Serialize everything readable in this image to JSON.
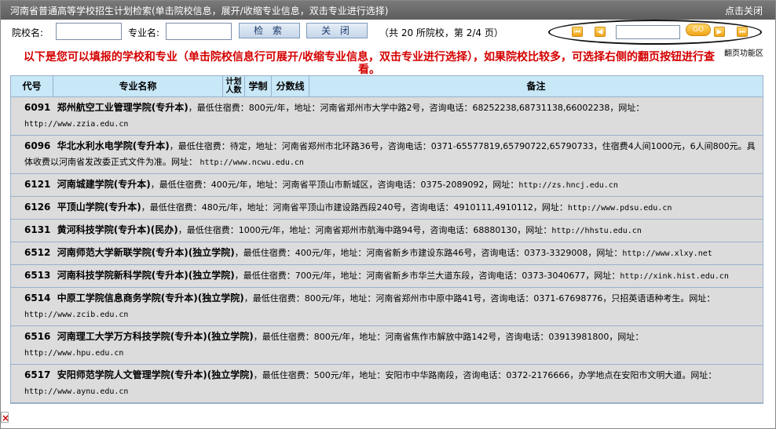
{
  "titlebar": {
    "title": "河南省普通高等学校招生计划检索(单击院校信息，展开/收缩专业信息，双击专业进行选择)",
    "close": "点击关闭"
  },
  "search": {
    "school_label": "院校名:",
    "school_value": "",
    "major_label": "专业名:",
    "major_value": "",
    "search_btn": "检 索",
    "close_btn": "关 闭",
    "page_info": "（共 20 所院校，第 2/4 页）"
  },
  "pager": {
    "first": "⏮",
    "prev": "◀",
    "input_value": "",
    "go": "GO",
    "next": "▶",
    "last": "⏭",
    "caption": "翻页功能区"
  },
  "notice": "以下是您可以填报的学校和专业（单击院校信息行可展开/收缩专业信息，双击专业进行选择），如果院校比较多，可选择右侧的翻页按钮进行查看。",
  "table": {
    "headers": [
      "代号",
      "专业名称",
      "计划人数",
      "学制",
      "分数线",
      "备注"
    ],
    "rows": [
      {
        "code": "6091",
        "name": "郑州航空工业管理学院(专升本)",
        "info": "，最低住宿费：800元/年，地址：河南省郑州市大学中路2号，咨询电话：68252238,68731138,66002238，网址：",
        "url": "http://www.zzia.edu.cn"
      },
      {
        "code": "6096",
        "name": "华北水利水电学院(专升本)",
        "info": "，最低住宿费：待定，地址：河南省郑州市北环路36号，咨询电话：0371-65577819,65790722,65790733，住宿费4人间1000元，6人间800元。具体收费以河南省发改委正式文件为准。网址：",
        "url": "http://www.ncwu.edu.cn"
      },
      {
        "code": "6121",
        "name": "河南城建学院(专升本)",
        "info": "，最低住宿费：400元/年，地址：河南省平顶山市新城区，咨询电话：0375-2089092，网址：",
        "url": "http://zs.hncj.edu.cn"
      },
      {
        "code": "6126",
        "name": "平顶山学院(专升本)",
        "info": "，最低住宿费：480元/年，地址：河南省平顶山市建设路西段240号，咨询电话：4910111,4910112，网址：",
        "url": "http://www.pdsu.edu.cn"
      },
      {
        "code": "6131",
        "name": "黄河科技学院(专升本)(民办)",
        "info": "，最低住宿费：1000元/年，地址：河南省郑州市航海中路94号，咨询电话：68880130，网址：",
        "url": "http://hhstu.edu.cn"
      },
      {
        "code": "6512",
        "name": "河南师范大学新联学院(专升本)(独立学院)",
        "info": "，最低住宿费：400元/年，地址：河南省新乡市建设东路46号，咨询电话：0373-3329008，网址：",
        "url": "http://www.xlxy.net"
      },
      {
        "code": "6513",
        "name": "河南科技学院新科学院(专升本)(独立学院)",
        "info": "，最低住宿费：700元/年，地址：河南省新乡市华兰大道东段，咨询电话：0373-3040677，网址：",
        "url": "http://xink.hist.edu.cn"
      },
      {
        "code": "6514",
        "name": "中原工学院信息商务学院(专升本)(独立学院)",
        "info": "，最低住宿费：800元/年，地址：河南省郑州市中原中路41号，咨询电话：0371-67698776，只招英语语种考生。网址：",
        "url": "http://www.zcib.edu.cn"
      },
      {
        "code": "6516",
        "name": "河南理工大学万方科技学院(专升本)(独立学院)",
        "info": "，最低住宿费：800元/年，地址：河南省焦作市解放中路142号，咨询电话：03913981800，网址：",
        "url": "http://www.hpu.edu.cn"
      },
      {
        "code": "6517",
        "name": "安阳师范学院人文管理学院(专升本)(独立学院)",
        "info": "，最低住宿费：500元/年，地址：安阳市中华路南段，咨询电话：0372-2176666，办学地点在安阳市文明大道。网址：",
        "url": "http://www.aynu.edu.cn"
      }
    ]
  },
  "footer": {
    "close_x": "×"
  }
}
